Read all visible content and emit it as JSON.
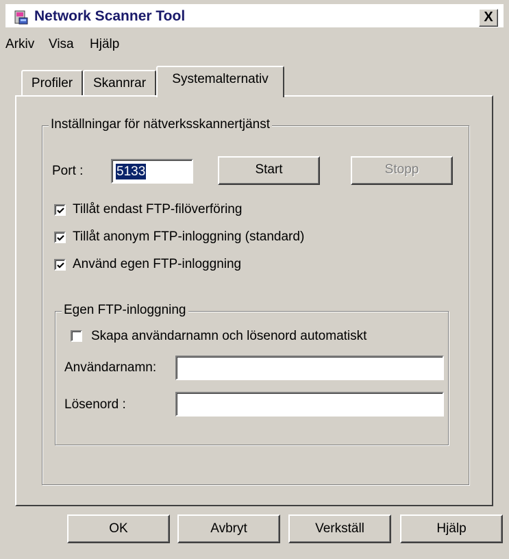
{
  "window": {
    "title": "Network Scanner Tool",
    "close_label": "X"
  },
  "menu": [
    "Arkiv",
    "Visa",
    "Hjälp"
  ],
  "tabs": [
    {
      "label": "Profiler",
      "active": false
    },
    {
      "label": "Skannrar",
      "active": false
    },
    {
      "label": "Systemalternativ",
      "active": true
    }
  ],
  "service_group": {
    "title": "Inställningar för nätverksskannertjänst",
    "port_label": "Port :",
    "port_value": "5133",
    "start_label": "Start",
    "stop_label": "Stopp",
    "options": [
      {
        "label": "Tillåt endast FTP-filöverföring",
        "checked": true
      },
      {
        "label": "Tillåt anonym FTP-inloggning (standard)",
        "checked": true
      },
      {
        "label": "Använd egen FTP-inloggning",
        "checked": true
      }
    ]
  },
  "ftp_group": {
    "title": "Egen FTP-inloggning",
    "auto_label": "Skapa användarnamn och lösenord automatiskt",
    "auto_checked": false,
    "username_label": "Användarnamn:",
    "username_value": "",
    "password_label": "Lösenord :",
    "password_value": ""
  },
  "buttons": {
    "ok": "OK",
    "cancel": "Avbryt",
    "apply": "Verkställ",
    "help": "Hjälp"
  }
}
